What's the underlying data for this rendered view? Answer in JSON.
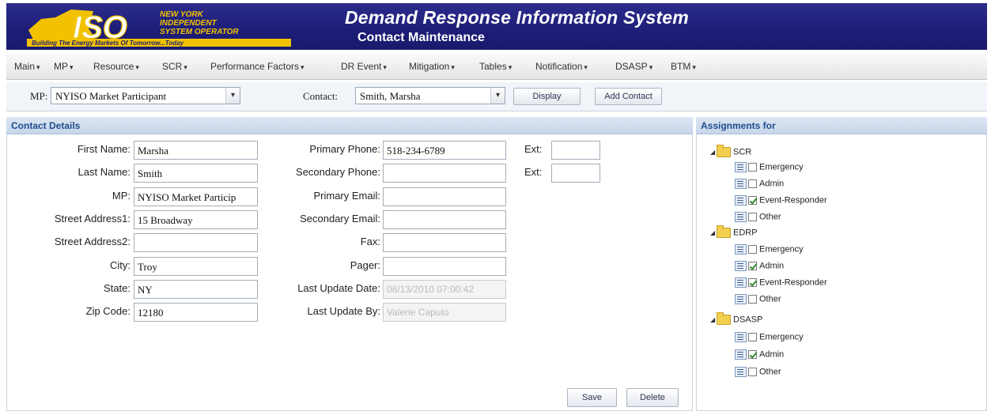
{
  "header": {
    "logo_main": "ISO",
    "logo_line1": "NEW YORK",
    "logo_line2": "INDEPENDENT",
    "logo_line3": "SYSTEM OPERATOR",
    "logo_tagline": "Building The Energy Markets Of Tomorrow...Today",
    "title": "Demand Response Information System",
    "subtitle": "Contact Maintenance"
  },
  "menu": [
    "Main",
    "MP",
    "Resource",
    "SCR",
    "Performance Factors",
    "DR Event",
    "Mitigation",
    "Tables",
    "Notification",
    "DSASP",
    "BTM"
  ],
  "toolbar": {
    "mp_label": "MP:",
    "mp_value": "NYISO Market Participant",
    "contact_label": "Contact:",
    "contact_value": "Smith, Marsha",
    "display_label": "Display",
    "add_contact_label": "Add Contact"
  },
  "contact_details": {
    "heading": "Contact Details",
    "first_name": {
      "label": "First Name:",
      "value": "Marsha"
    },
    "last_name": {
      "label": "Last Name:",
      "value": "Smith"
    },
    "mp": {
      "label": "MP:",
      "value": "NYISO Market Particip"
    },
    "street1": {
      "label": "Street Address1:",
      "value": "15 Broadway"
    },
    "street2": {
      "label": "Street Address2:",
      "value": ""
    },
    "city": {
      "label": "City:",
      "value": "Troy"
    },
    "state": {
      "label": "State:",
      "value": "NY"
    },
    "zip": {
      "label": "Zip Code:",
      "value": "12180"
    },
    "primary_phone": {
      "label": "Primary Phone:",
      "value": "518-234-6789"
    },
    "secondary_phone": {
      "label": "Secondary Phone:",
      "value": ""
    },
    "primary_email": {
      "label": "Primary Email:",
      "value": ""
    },
    "secondary_email": {
      "label": "Secondary Email:",
      "value": ""
    },
    "fax": {
      "label": "Fax:",
      "value": ""
    },
    "pager": {
      "label": "Pager:",
      "value": ""
    },
    "last_update_date": {
      "label": "Last Update Date:",
      "value": "08/13/2010 07:00:42"
    },
    "last_update_by": {
      "label": "Last Update By:",
      "value": "Valerie Caputo"
    },
    "ext1": {
      "label": "Ext:",
      "value": ""
    },
    "ext2": {
      "label": "Ext:",
      "value": ""
    },
    "save_label": "Save",
    "delete_label": "Delete"
  },
  "assignments": {
    "heading": "Assignments for",
    "groups": [
      {
        "name": "SCR",
        "items": [
          {
            "label": "Emergency",
            "checked": false
          },
          {
            "label": "Admin",
            "checked": false
          },
          {
            "label": "Event-Responder",
            "checked": true
          },
          {
            "label": "Other",
            "checked": false
          }
        ]
      },
      {
        "name": "EDRP",
        "items": [
          {
            "label": "Emergency",
            "checked": false
          },
          {
            "label": "Admin",
            "checked": true
          },
          {
            "label": "Event-Responder",
            "checked": true
          },
          {
            "label": "Other",
            "checked": false
          }
        ]
      },
      {
        "name": "DSASP",
        "items": [
          {
            "label": "Emergency",
            "checked": false
          },
          {
            "label": "Admin",
            "checked": true
          },
          {
            "label": "Other",
            "checked": false
          }
        ]
      }
    ]
  },
  "colors": {
    "header_bg": "#1d1d78",
    "logo_yellow": "#f2c200",
    "panel_head_text": "#1f4d8c",
    "check_green": "#2e8b2e"
  }
}
